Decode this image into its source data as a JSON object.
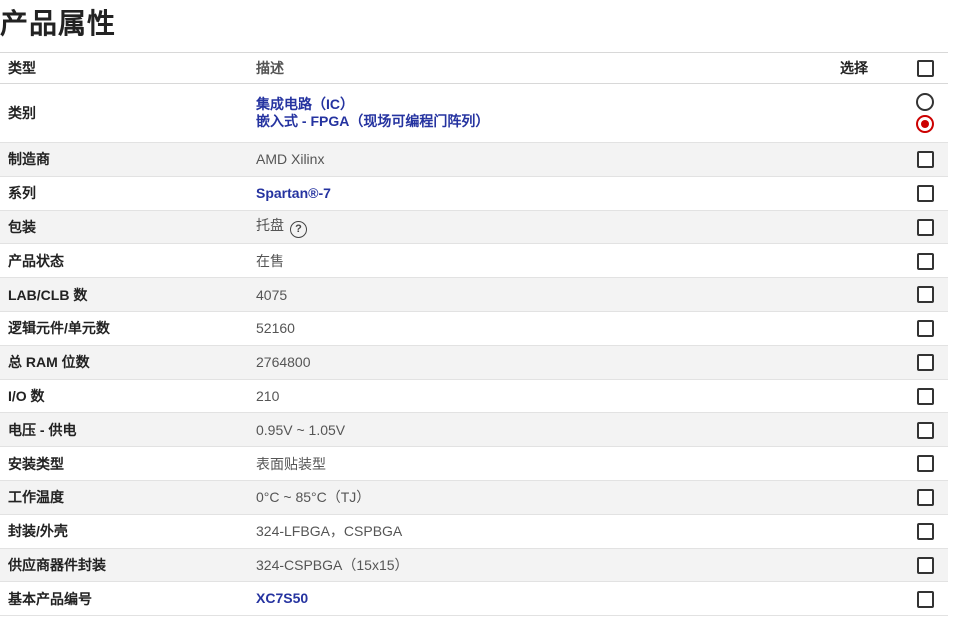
{
  "page_title": "产品属性",
  "table": {
    "headers": {
      "type": "类型",
      "description": "描述",
      "select": "选择"
    },
    "rows": [
      {
        "name": "类别",
        "values": [
          "集成电路（IC）",
          "嵌入式 - FPGA（现场可编程门阵列）"
        ],
        "link": true,
        "control": "radio",
        "selected_index": 1
      },
      {
        "name": "制造商",
        "value": "AMD Xilinx"
      },
      {
        "name": "系列",
        "value": "Spartan®-7",
        "link": true
      },
      {
        "name": "包装",
        "value": "托盘",
        "help": "?"
      },
      {
        "name": "产品状态",
        "value": "在售"
      },
      {
        "name": "LAB/CLB 数",
        "value": "4075"
      },
      {
        "name": "逻辑元件/单元数",
        "value": "52160"
      },
      {
        "name": "总 RAM 位数",
        "value": "2764800"
      },
      {
        "name": "I/O 数",
        "value": "210"
      },
      {
        "name": "电压 - 供电",
        "value": "0.95V ~ 1.05V"
      },
      {
        "name": "安装类型",
        "value": "表面贴装型"
      },
      {
        "name": "工作温度",
        "value": "0°C ~ 85°C（TJ）"
      },
      {
        "name": "封装/外壳",
        "value": "324-LFBGA，CSPBGA"
      },
      {
        "name": "供应商器件封装",
        "value": "324-CSPBGA（15x15）"
      },
      {
        "name": "基本产品编号",
        "value": "XC7S50",
        "link": true
      }
    ]
  },
  "colors": {
    "link": "#2533a0",
    "radio_selected": "#cc0000",
    "row_alt": "#f3f3f3"
  }
}
